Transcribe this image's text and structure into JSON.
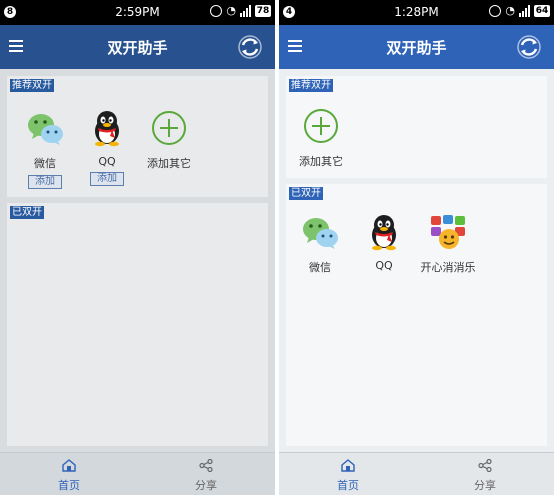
{
  "colors": {
    "primary": "#2e63b7",
    "addIcon": "#5aa83a"
  },
  "left": {
    "status": {
      "notif_badge": "8",
      "time": "2:59PM",
      "battery": "78"
    },
    "appbar": {
      "title": "双开助手"
    },
    "recommended": {
      "title": "推荐双开",
      "apps": [
        {
          "name": "微信",
          "action": "添加",
          "icon": "wechat-icon"
        },
        {
          "name": "QQ",
          "action": "添加",
          "icon": "qq-icon"
        },
        {
          "name": "添加其它",
          "icon": "add-icon"
        }
      ]
    },
    "opened": {
      "title": "已双开",
      "apps": []
    },
    "nav": [
      {
        "label": "首页",
        "icon": "home-icon"
      },
      {
        "label": "分享",
        "icon": "share-icon"
      }
    ]
  },
  "right": {
    "status": {
      "notif_badge": "4",
      "time": "1:28PM",
      "battery": "64"
    },
    "appbar": {
      "title": "双开助手"
    },
    "recommended": {
      "title": "推荐双开",
      "apps": [
        {
          "name": "添加其它",
          "icon": "add-icon"
        }
      ]
    },
    "opened": {
      "title": "已双开",
      "apps": [
        {
          "name": "微信",
          "icon": "wechat-icon"
        },
        {
          "name": "QQ",
          "icon": "qq-icon"
        },
        {
          "name": "开心消消乐",
          "icon": "happy-elimination-icon"
        }
      ]
    },
    "nav": [
      {
        "label": "首页",
        "icon": "home-icon"
      },
      {
        "label": "分享",
        "icon": "share-icon"
      }
    ]
  }
}
